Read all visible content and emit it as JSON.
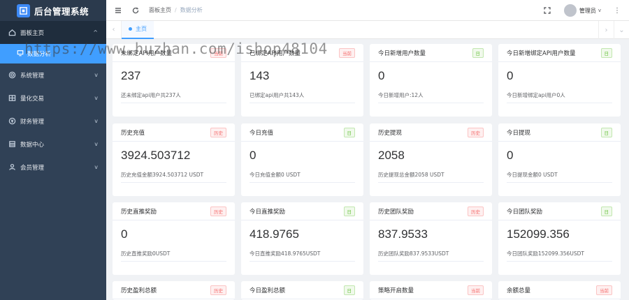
{
  "app": {
    "title": "后台管理系统"
  },
  "sidebar": {
    "items": [
      {
        "label": "面板主页",
        "arrow": "^",
        "icon": "home-icon"
      },
      {
        "label": "数据分析",
        "icon": "chart-icon"
      },
      {
        "label": "系统管理",
        "arrow": "v",
        "icon": "gear-icon"
      },
      {
        "label": "量化交易",
        "arrow": "v",
        "icon": "grid-icon"
      },
      {
        "label": "财务管理",
        "arrow": "v",
        "icon": "coin-icon"
      },
      {
        "label": "数据中心",
        "arrow": "v",
        "icon": "database-icon"
      },
      {
        "label": "会员管理",
        "arrow": "v",
        "icon": "user-icon"
      }
    ]
  },
  "header": {
    "breadcrumb": [
      "面板主页",
      "数据分析"
    ],
    "separator": "/",
    "user": "管理员",
    "user_arrow": "v",
    "more": "⋮"
  },
  "tabs": {
    "items": [
      "主页"
    ],
    "prev": "‹",
    "next": "›",
    "dropdown": "⌄"
  },
  "watermark": "https://www.huzhan.com/ishop48104",
  "cards": [
    {
      "title": "未绑定API用户数量",
      "badge": "当前",
      "value": "237",
      "desc": "还未绑定api用户共237人"
    },
    {
      "title": "已绑定API用户数量",
      "badge": "当前",
      "value": "143",
      "desc": "已绑定api用户共143人"
    },
    {
      "title": "今日新增用户数量",
      "badge": "日",
      "value": "0",
      "desc": "今日新增用户:12人"
    },
    {
      "title": "今日新增绑定API用户数量",
      "badge": "日",
      "value": "0",
      "desc": "今日新增绑定api用户0人"
    },
    {
      "title": "历史充值",
      "badge": "历史",
      "value": "3924.503712",
      "desc": "历史充值金额3924.503712 USDT"
    },
    {
      "title": "今日充值",
      "badge": "日",
      "value": "0",
      "desc": "今日充值金额0 USDT"
    },
    {
      "title": "历史提现",
      "badge": "历史",
      "value": "2058",
      "desc": "历史提现总金额2058 USDT"
    },
    {
      "title": "今日提现",
      "badge": "日",
      "value": "0",
      "desc": "今日提现金额0 USDT"
    },
    {
      "title": "历史直推奖励",
      "badge": "历史",
      "value": "0",
      "desc": "历史直推奖励0USDT"
    },
    {
      "title": "今日直推奖励",
      "badge": "日",
      "value": "418.9765",
      "desc": "今日直推奖励418.9765USDT"
    },
    {
      "title": "历史团队奖励",
      "badge": "历史",
      "value": "837.9533",
      "desc": "历史团队奖励837.9533USDT"
    },
    {
      "title": "今日团队奖励",
      "badge": "日",
      "value": "152099.356",
      "desc": "今日团队奖励152099.356USDT"
    },
    {
      "title": "历史盈利总额",
      "badge": "历史",
      "value": "",
      "desc": ""
    },
    {
      "title": "今日盈利总额",
      "badge": "日",
      "value": "",
      "desc": ""
    },
    {
      "title": "策略开启数量",
      "badge": "当前",
      "value": "",
      "desc": ""
    },
    {
      "title": "余额总量",
      "badge": "当前",
      "value": "",
      "desc": ""
    }
  ]
}
